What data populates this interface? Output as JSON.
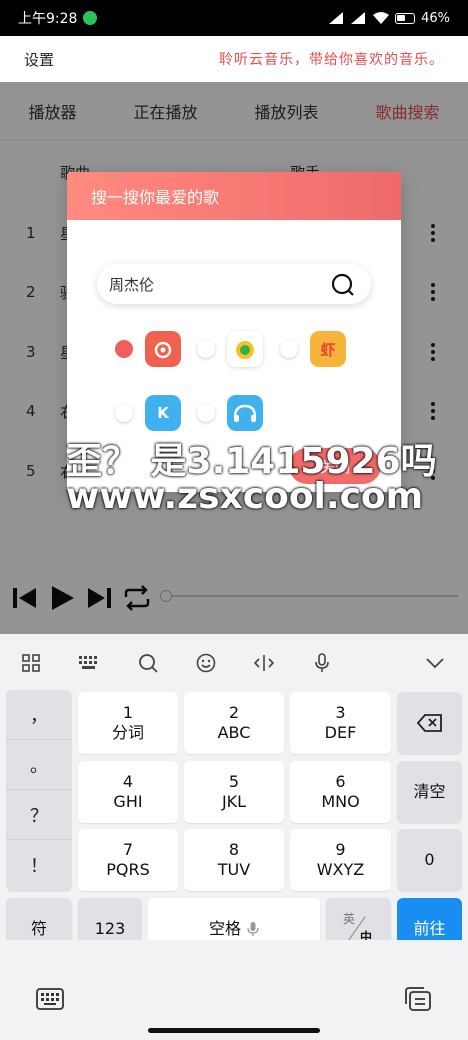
{
  "status_bar": {
    "time": "上午9:28",
    "battery": "46%"
  },
  "header": {
    "title": "设置",
    "slogan": "聆听云音乐，带给你喜欢的音乐。"
  },
  "tabs": [
    {
      "label": "播放器"
    },
    {
      "label": "正在播放"
    },
    {
      "label": "播放列表"
    },
    {
      "label": "歌曲搜索"
    }
  ],
  "list": {
    "col_song": "歌曲",
    "col_singer": "歌手",
    "rows": [
      {
        "num": "1",
        "name": "星"
      },
      {
        "num": "2",
        "name": "骄"
      },
      {
        "num": "3",
        "name": "星"
      },
      {
        "num": "4",
        "name": "右"
      },
      {
        "num": "5",
        "name": "右"
      }
    ]
  },
  "dialog": {
    "title": "搜一搜你最爱的歌",
    "search_value": "周杰伦",
    "close_label": "关闭",
    "sources": [
      {
        "id": "netease",
        "icon": "netease-music-icon",
        "color": "#f0624d",
        "selected": true
      },
      {
        "id": "qq",
        "icon": "qq-music-icon",
        "color": "#ffffff",
        "selected": false
      },
      {
        "id": "xiami",
        "icon": "xiami-music-icon",
        "color": "#f7b33c",
        "glyph": "虾",
        "selected": false
      },
      {
        "id": "kugou",
        "icon": "kugou-music-icon",
        "color": "#3fb1ef",
        "glyph": "K",
        "selected": false
      },
      {
        "id": "baidu",
        "icon": "baidu-music-icon",
        "color": "#3fb1ef",
        "selected": false
      }
    ]
  },
  "watermark": {
    "line1": "歪？ 是3.1415926吗",
    "line2": "www.zsxcool.com"
  },
  "keyboard": {
    "punctuation": [
      "，",
      "。",
      "？",
      "！"
    ],
    "keys": [
      {
        "num": "1",
        "letters": "分词"
      },
      {
        "num": "2",
        "letters": "ABC"
      },
      {
        "num": "3",
        "letters": "DEF"
      },
      {
        "num": "4",
        "letters": "GHI"
      },
      {
        "num": "5",
        "letters": "JKL"
      },
      {
        "num": "6",
        "letters": "MNO"
      },
      {
        "num": "7",
        "letters": "PQRS"
      },
      {
        "num": "8",
        "letters": "TUV"
      },
      {
        "num": "9",
        "letters": "WXYZ"
      }
    ],
    "clear_label": "清空",
    "zero_label": "0",
    "symbol_label": "符",
    "num_label": "123",
    "space_label": "空格",
    "lang_top": "英",
    "lang_bottom": "中",
    "go_label": "前往"
  }
}
